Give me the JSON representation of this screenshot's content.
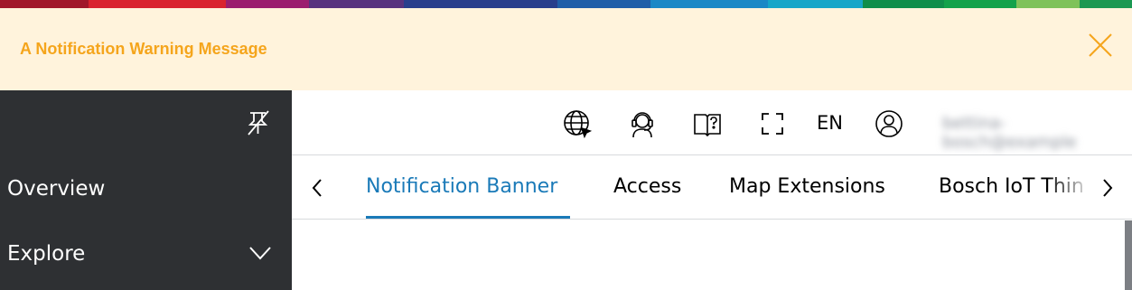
{
  "brand_colors": [
    "#a1182b",
    "#d9232f",
    "#9b1d6f",
    "#57327e",
    "#283e8c",
    "#1f5ea8",
    "#1a88c6",
    "#16a6c8",
    "#0f8e4b",
    "#12a24b",
    "#7fc25a",
    "#1b9852"
  ],
  "notification": {
    "message": "A Notification Warning Message",
    "close_icon": "close-icon",
    "color": "#f5a51c",
    "background": "#fff3dc"
  },
  "sidebar": {
    "pin_icon": "unpin-icon",
    "items": [
      {
        "label": "Overview"
      },
      {
        "label": "Explore",
        "icon": "chevron-down-icon"
      }
    ]
  },
  "header": {
    "icons": [
      "globe-cursor-icon",
      "support-agent-icon",
      "documentation-icon",
      "fullscreen-icon"
    ],
    "language": "EN",
    "user_icon": "user-icon",
    "username": "bettina-bosch@example"
  },
  "tabs": {
    "items": [
      {
        "label": "Notification Banner",
        "active": true
      },
      {
        "label": "Access"
      },
      {
        "label": "Map Extensions"
      },
      {
        "label": "Bosch IoT Things"
      }
    ],
    "active_color": "#1a7ab8"
  }
}
